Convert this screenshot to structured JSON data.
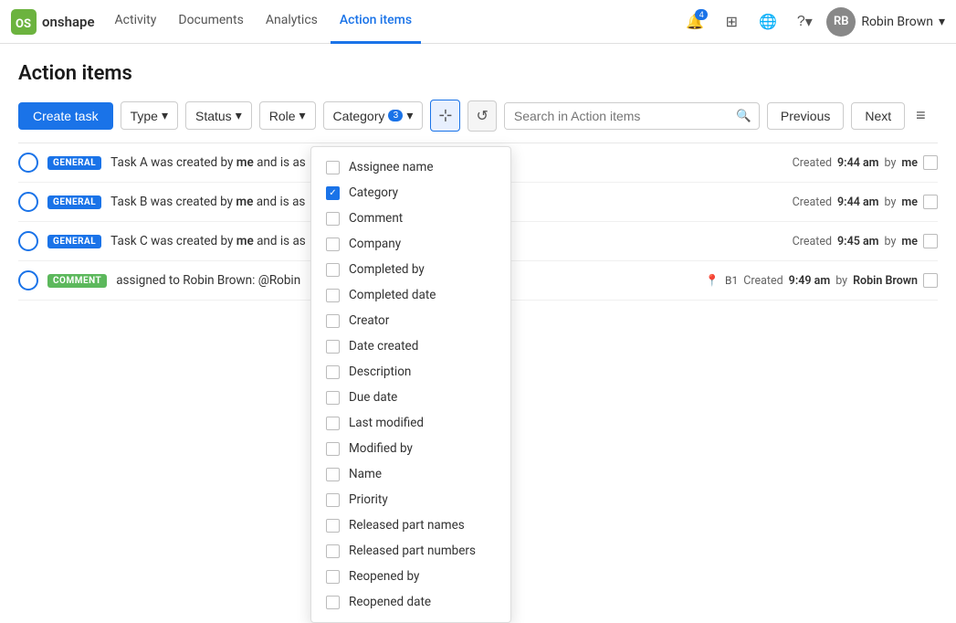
{
  "navbar": {
    "logo_text": "onshape",
    "links": [
      {
        "label": "Activity",
        "active": false
      },
      {
        "label": "Documents",
        "active": false
      },
      {
        "label": "Analytics",
        "active": false
      },
      {
        "label": "Action items",
        "active": true
      }
    ],
    "notification_badge": "4",
    "user_name": "Robin Brown",
    "user_initials": "RB",
    "help_label": "?"
  },
  "page": {
    "title": "Action items"
  },
  "toolbar": {
    "create_task_label": "Create task",
    "type_label": "Type",
    "status_label": "Status",
    "role_label": "Role",
    "category_label": "Category",
    "filter_badge": "3",
    "search_placeholder": "Search in Action items",
    "previous_label": "Previous",
    "next_label": "Next"
  },
  "tasks": [
    {
      "badge": "GENERAL",
      "badge_type": "general",
      "text": "Task A was created by me and is as",
      "meta_time": "9:44 am",
      "meta_user": "me",
      "pin": false
    },
    {
      "badge": "GENERAL",
      "badge_type": "general",
      "text": "Task B was created by me and is as",
      "meta_time": "9:44 am",
      "meta_user": "me",
      "pin": false
    },
    {
      "badge": "GENERAL",
      "badge_type": "general",
      "text": "Task C was created by me and is as",
      "meta_time": "9:45 am",
      "meta_user": "me",
      "pin": false
    },
    {
      "badge": "COMMENT",
      "badge_type": "comment",
      "text": "assigned to Robin Brown: @Robin",
      "meta_time": "9:49 am",
      "meta_user": "Robin Brown",
      "pin": true,
      "pin_label": "B1"
    }
  ],
  "dropdown": {
    "items": [
      {
        "label": "Assignee name",
        "checked": false
      },
      {
        "label": "Category",
        "checked": true
      },
      {
        "label": "Comment",
        "checked": false
      },
      {
        "label": "Company",
        "checked": false
      },
      {
        "label": "Completed by",
        "checked": false
      },
      {
        "label": "Completed date",
        "checked": false
      },
      {
        "label": "Creator",
        "checked": false
      },
      {
        "label": "Date created",
        "checked": false
      },
      {
        "label": "Description",
        "checked": false
      },
      {
        "label": "Due date",
        "checked": false
      },
      {
        "label": "Last modified",
        "checked": false
      },
      {
        "label": "Modified by",
        "checked": false
      },
      {
        "label": "Name",
        "checked": false
      },
      {
        "label": "Priority",
        "checked": false
      },
      {
        "label": "Released part names",
        "checked": false
      },
      {
        "label": "Released part numbers",
        "checked": false
      },
      {
        "label": "Reopened by",
        "checked": false
      },
      {
        "label": "Reopened date",
        "checked": false
      }
    ]
  },
  "icons": {
    "check": "✓",
    "chevron_down": "▾",
    "search": "🔍",
    "columns": "⊞",
    "history": "↺",
    "list": "≡",
    "pin": "📍"
  }
}
